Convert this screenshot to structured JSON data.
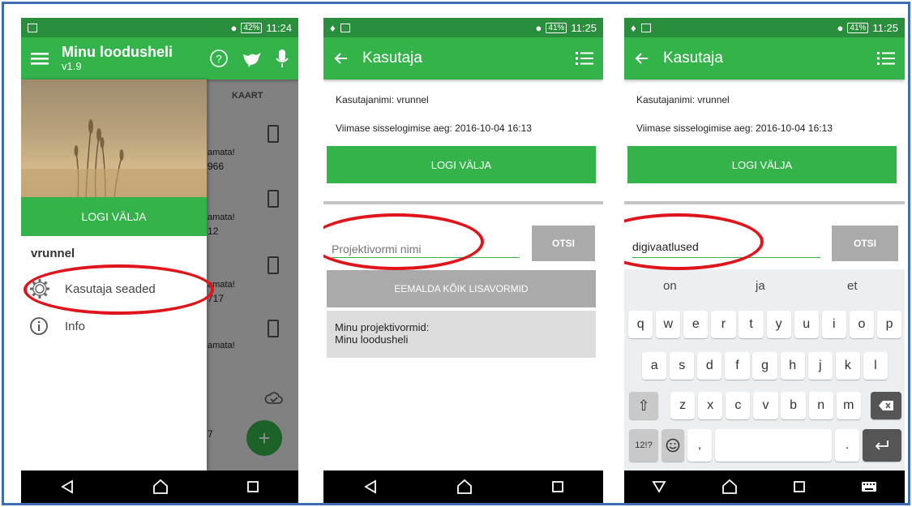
{
  "status": {
    "p1": {
      "battery": "42%",
      "time": "11:24"
    },
    "p2": {
      "battery": "41%",
      "time": "11:25"
    },
    "p3": {
      "battery": "41%",
      "time": "11:25"
    }
  },
  "drawer_screen": {
    "app_title": "Minu loodusheli",
    "app_version": "v1.9",
    "tab_label": "KAART",
    "logout_label": "LOGI VÄLJA",
    "username": "vrunnel",
    "menu": [
      {
        "label": "Kasutaja seaded",
        "icon": "gear-icon"
      },
      {
        "label": "Info",
        "icon": "info-icon"
      }
    ],
    "background_snippets": [
      "amata!",
      "966",
      "amata!",
      "12",
      "amata!",
      "717",
      "amata!",
      "7"
    ]
  },
  "user_screen": {
    "title": "Kasutaja",
    "username_line": "Kasutajanimi: vrunnel",
    "last_login_line": "Viimase sisselogimise aeg: 2016-10-04 16:13",
    "logout_label": "LOGI VÄLJA",
    "search_placeholder": "Projektivormi nimi",
    "search_button": "OTSI",
    "remove_all_label": "EEMALDA KÕIK LISAVORMID",
    "forms_heading": "Minu projektivormid:",
    "forms_item": "Minu loodusheli"
  },
  "keyboard_screen": {
    "title": "Kasutaja",
    "username_line": "Kasutajanimi: vrunnel",
    "last_login_line": "Viimase sisselogimise aeg: 2016-10-04 16:13",
    "logout_label": "LOGI VÄLJA",
    "search_value": "digivaatlused",
    "search_button": "OTSI",
    "suggestions": [
      "on",
      "ja",
      "et"
    ],
    "row1": [
      "q",
      "w",
      "e",
      "r",
      "t",
      "y",
      "u",
      "i",
      "o",
      "p"
    ],
    "row2": [
      "a",
      "s",
      "d",
      "f",
      "g",
      "h",
      "j",
      "k",
      "l"
    ],
    "row3": [
      "z",
      "x",
      "c",
      "v",
      "b",
      "n",
      "m"
    ],
    "symbols_key": "12!?",
    "comma_key": ",",
    "period_key": "."
  },
  "colors": {
    "primary": "#34b34a",
    "status_bar": "#2a8f3d",
    "highlight": "#e0141b"
  }
}
